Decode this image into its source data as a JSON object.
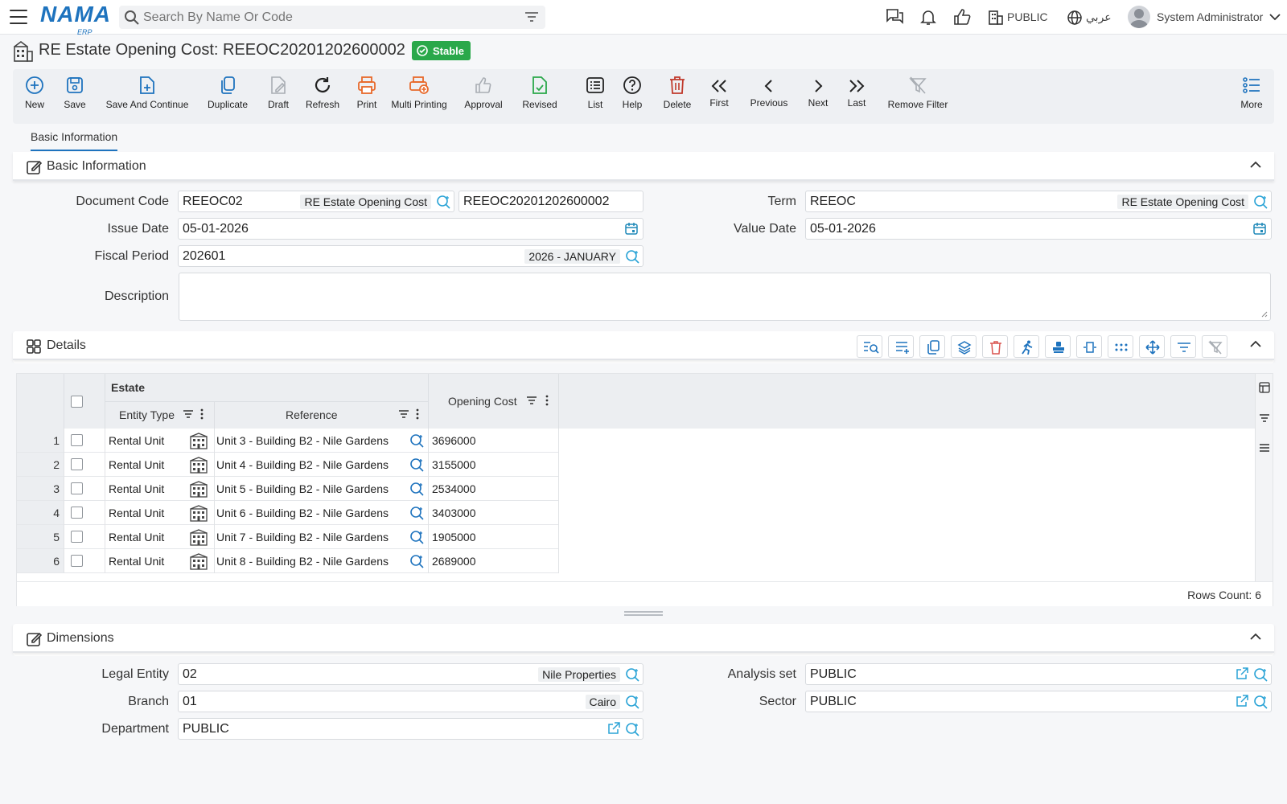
{
  "topbar": {
    "logo": "NAMA",
    "logo_sub": "ERP",
    "search_placeholder": "Search By Name Or Code",
    "company": "PUBLIC",
    "language": "عربي",
    "user": "System Administrator"
  },
  "page": {
    "title": "RE Estate Opening Cost: REEOC20201202600002",
    "status": "Stable"
  },
  "toolbar": {
    "new": "New",
    "save": "Save",
    "save_continue": "Save And Continue",
    "duplicate": "Duplicate",
    "draft": "Draft",
    "refresh": "Refresh",
    "print": "Print",
    "multi_printing": "Multi Printing",
    "approval": "Approval",
    "revised": "Revised",
    "list": "List",
    "help": "Help",
    "delete": "Delete",
    "first": "First",
    "previous": "Previous",
    "next": "Next",
    "last": "Last",
    "remove_filter": "Remove Filter",
    "more": "More"
  },
  "tabs": [
    "Basic Information"
  ],
  "basic": {
    "title": "Basic Information",
    "document_code_label": "Document Code",
    "document_code": "REEOC02",
    "document_code_name": "RE Estate Opening Cost",
    "document_number": "REEOC20201202600002",
    "term_label": "Term",
    "term": "REEOC",
    "term_name": "RE Estate Opening Cost",
    "issue_date_label": "Issue Date",
    "issue_date": "05-01-2026",
    "value_date_label": "Value Date",
    "value_date": "05-01-2026",
    "fiscal_period_label": "Fiscal Period",
    "fiscal_period": "202601",
    "fiscal_period_name": "2026 - JANUARY",
    "description_label": "Description",
    "description": ""
  },
  "details": {
    "title": "Details",
    "group_header": "Estate",
    "col_entity_type": "Entity Type",
    "col_reference": "Reference",
    "col_opening_cost": "Opening Cost",
    "rows": [
      {
        "n": "1",
        "entity_type": "Rental Unit",
        "reference": "Unit 3 - Building B2 - Nile Gardens",
        "opening_cost": "3696000"
      },
      {
        "n": "2",
        "entity_type": "Rental Unit",
        "reference": "Unit 4 - Building B2 - Nile Gardens",
        "opening_cost": "3155000"
      },
      {
        "n": "3",
        "entity_type": "Rental Unit",
        "reference": "Unit 5 - Building B2 - Nile Gardens",
        "opening_cost": "2534000"
      },
      {
        "n": "4",
        "entity_type": "Rental Unit",
        "reference": "Unit 6 - Building B2 - Nile Gardens",
        "opening_cost": "3403000"
      },
      {
        "n": "5",
        "entity_type": "Rental Unit",
        "reference": "Unit 7 - Building B2 - Nile Gardens",
        "opening_cost": "1905000"
      },
      {
        "n": "6",
        "entity_type": "Rental Unit",
        "reference": "Unit 8 - Building B2 - Nile Gardens",
        "opening_cost": "2689000"
      }
    ],
    "rows_count": "Rows Count: 6"
  },
  "dimensions": {
    "title": "Dimensions",
    "legal_entity_label": "Legal Entity",
    "legal_entity": "02",
    "legal_entity_name": "Nile Properties",
    "analysis_set_label": "Analysis set",
    "analysis_set": "PUBLIC",
    "branch_label": "Branch",
    "branch": "01",
    "branch_name": "Cairo",
    "sector_label": "Sector",
    "sector": "PUBLIC",
    "department_label": "Department",
    "department": "PUBLIC"
  },
  "colors": {
    "accent": "#1e73be",
    "stable": "#2aa84a",
    "print": "#e8692a",
    "delete": "#c0392b",
    "revised": "#2aa84a"
  }
}
